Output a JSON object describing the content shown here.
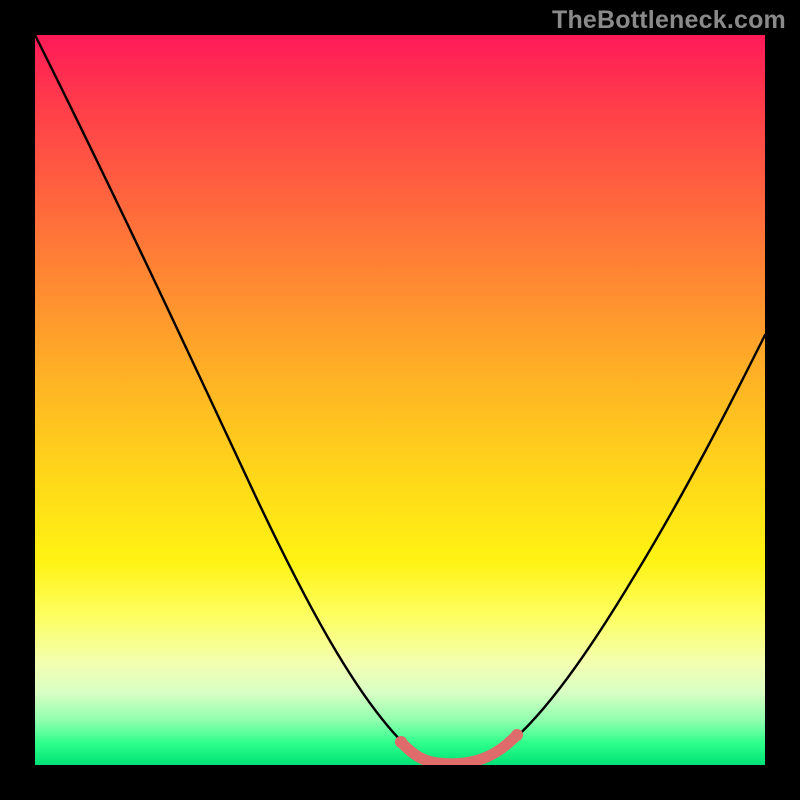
{
  "watermark": "TheBottleneck.com",
  "chart_data": {
    "type": "line",
    "title": "",
    "xlabel": "",
    "ylabel": "",
    "x": [
      0.0,
      0.05,
      0.1,
      0.15,
      0.2,
      0.25,
      0.3,
      0.35,
      0.4,
      0.45,
      0.5,
      0.53,
      0.56,
      0.59,
      0.62,
      0.65,
      0.7,
      0.75,
      0.8,
      0.85,
      0.9,
      0.95,
      1.0
    ],
    "values": [
      1.0,
      0.87,
      0.74,
      0.62,
      0.5,
      0.41,
      0.32,
      0.24,
      0.17,
      0.11,
      0.06,
      0.03,
      0.01,
      0.0,
      0.01,
      0.03,
      0.08,
      0.15,
      0.24,
      0.34,
      0.45,
      0.55,
      0.65
    ],
    "highlight_range_x": [
      0.5,
      0.65
    ],
    "xlim": [
      0,
      1
    ],
    "ylim": [
      0,
      1
    ],
    "background_gradient": [
      "#ff1a58",
      "#ff6a3c",
      "#ffd61a",
      "#fdff66",
      "#00e276"
    ],
    "curve_color": "#000000",
    "highlight_color": "#e06666"
  }
}
